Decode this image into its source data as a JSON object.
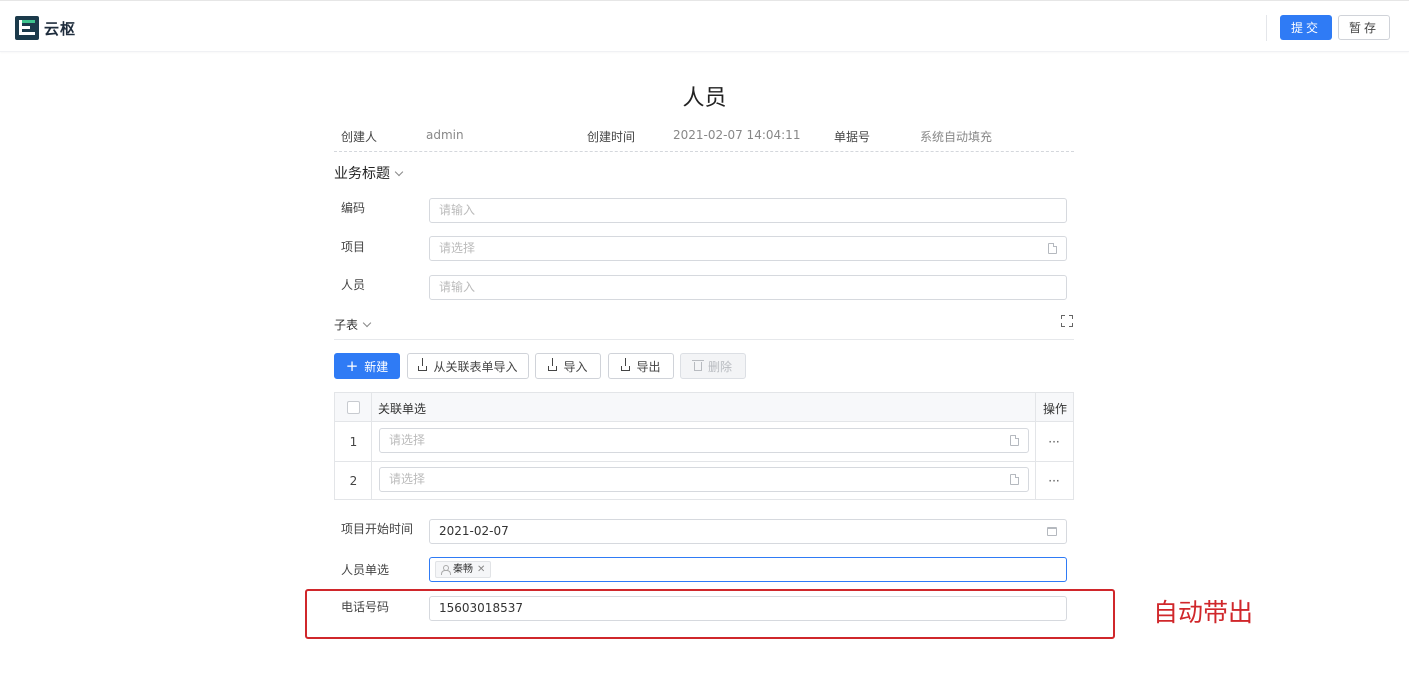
{
  "header": {
    "logo_text": "云枢",
    "submit_label": "提交",
    "draft_label": "暂存"
  },
  "form": {
    "title": "人员",
    "meta": {
      "creator_label": "创建人",
      "creator_value": "admin",
      "created_time_label": "创建时间",
      "created_time_value": "2021-02-07 14:04:11",
      "doc_no_label": "单据号",
      "doc_no_value": "系统自动填充"
    },
    "section_title": "业务标题",
    "fields": {
      "code": {
        "label": "编码",
        "placeholder": "请输入"
      },
      "project": {
        "label": "项目",
        "placeholder": "请选择"
      },
      "person": {
        "label": "人员",
        "placeholder": "请输入"
      },
      "start_date": {
        "label": "项目开始时间",
        "value": "2021-02-07"
      },
      "person_select": {
        "label": "人员单选",
        "tag": "秦畅"
      },
      "phone": {
        "label": "电话号码",
        "value": "15603018537"
      }
    },
    "subtable": {
      "title": "子表",
      "toolbar": {
        "new": "新建",
        "import_related": "从关联表单导入",
        "import": "导入",
        "export": "导出",
        "delete": "删除"
      },
      "columns": {
        "related": "关联单选",
        "actions": "操作"
      },
      "rows": [
        {
          "num": "1",
          "placeholder": "请选择",
          "more": "···"
        },
        {
          "num": "2",
          "placeholder": "请选择",
          "more": "···"
        }
      ]
    }
  },
  "annotation": {
    "text": "自动带出",
    "color": "#d0272b"
  },
  "colors": {
    "primary": "#2f7bf5"
  }
}
